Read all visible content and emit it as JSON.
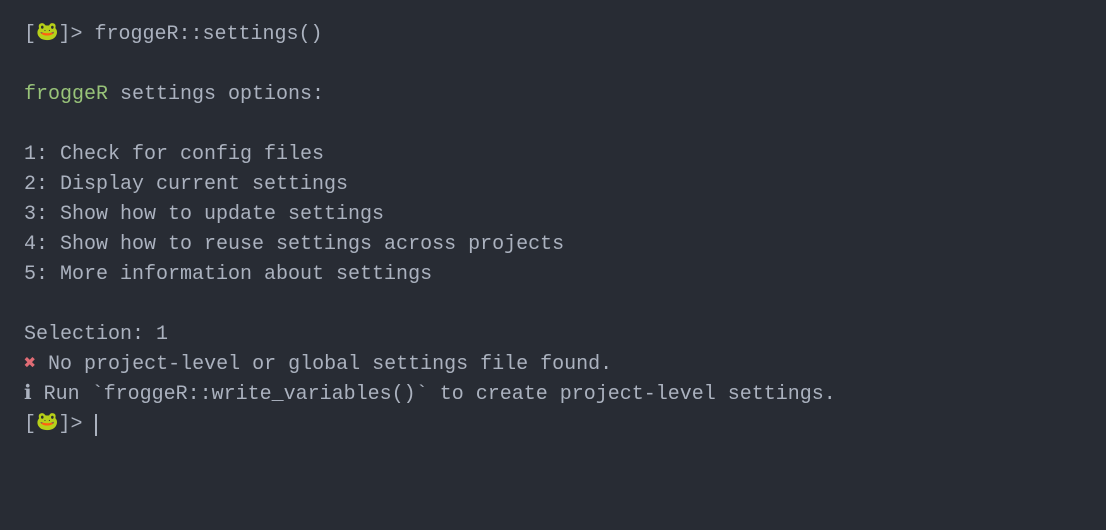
{
  "prompt": {
    "open_bracket": "[",
    "frog_emoji": "🐸",
    "close_prompt": "]> ",
    "command": "froggeR::settings()"
  },
  "header": {
    "package_name": "froggeR",
    "rest": " settings options:"
  },
  "options": [
    "1: Check for config files",
    "2: Display current settings",
    "3: Show how to update settings",
    "4: Show how to reuse settings across projects",
    "5: More information about settings"
  ],
  "selection_line": "Selection: 1",
  "error": {
    "mark": "✖",
    "text": " No project-level or global settings file found."
  },
  "info": {
    "mark": "ℹ",
    "text_before": " Run `",
    "code": "froggeR::write_variables()",
    "text_after": "` to create project-level settings."
  }
}
